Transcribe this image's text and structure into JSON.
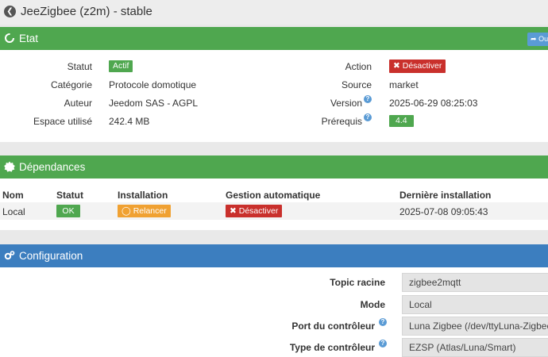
{
  "header": {
    "title": "JeeZigbee (z2m) - stable"
  },
  "etat": {
    "title": "Etat",
    "corner_button": "Ou",
    "left": [
      {
        "label": "Statut",
        "value": "Actif"
      },
      {
        "label": "Catégorie",
        "value": "Protocole domotique"
      },
      {
        "label": "Auteur",
        "value": "Jeedom SAS",
        "value_suffix": " - AGPL"
      },
      {
        "label": "Espace utilisé",
        "value": "242.4 MB"
      }
    ],
    "right": [
      {
        "label": "Action",
        "value": "Désactiver"
      },
      {
        "label": "Source",
        "value": "market"
      },
      {
        "label": "Version",
        "value": "2025-06-29 08:25:03"
      },
      {
        "label": "Prérequis",
        "value": "4.4"
      }
    ]
  },
  "dependances": {
    "title": "Dépendances",
    "headers": [
      "Nom",
      "Statut",
      "Installation",
      "Gestion automatique",
      "Dernière installation"
    ],
    "row": {
      "nom": "Local",
      "statut": "OK",
      "installation": "Relancer",
      "gestion": "Désactiver",
      "derniere": "2025-07-08 09:05:43"
    }
  },
  "configuration": {
    "title": "Configuration",
    "fields": [
      {
        "label": "Topic racine",
        "value": "zigbee2mqtt"
      },
      {
        "label": "Mode",
        "value": "Local"
      },
      {
        "label": "Port du contrôleur",
        "value": "Luna Zigbee (/dev/ttyLuna-Zigbee)"
      },
      {
        "label": "Type de contrôleur",
        "value": "EZSP (Atlas/Luna/Smart)"
      }
    ]
  },
  "colors": {
    "green": "#4fa74f",
    "blue": "#3c7ebf",
    "red": "#c9302c",
    "orange": "#f0a132",
    "help": "#5a9bd5"
  },
  "icons": [
    "arrow-circle-left-icon",
    "circle-notch-icon",
    "certificate-icon",
    "cogs-icon",
    "share-icon",
    "question-circle-icon",
    "times-icon",
    "bicycle-icon"
  ]
}
